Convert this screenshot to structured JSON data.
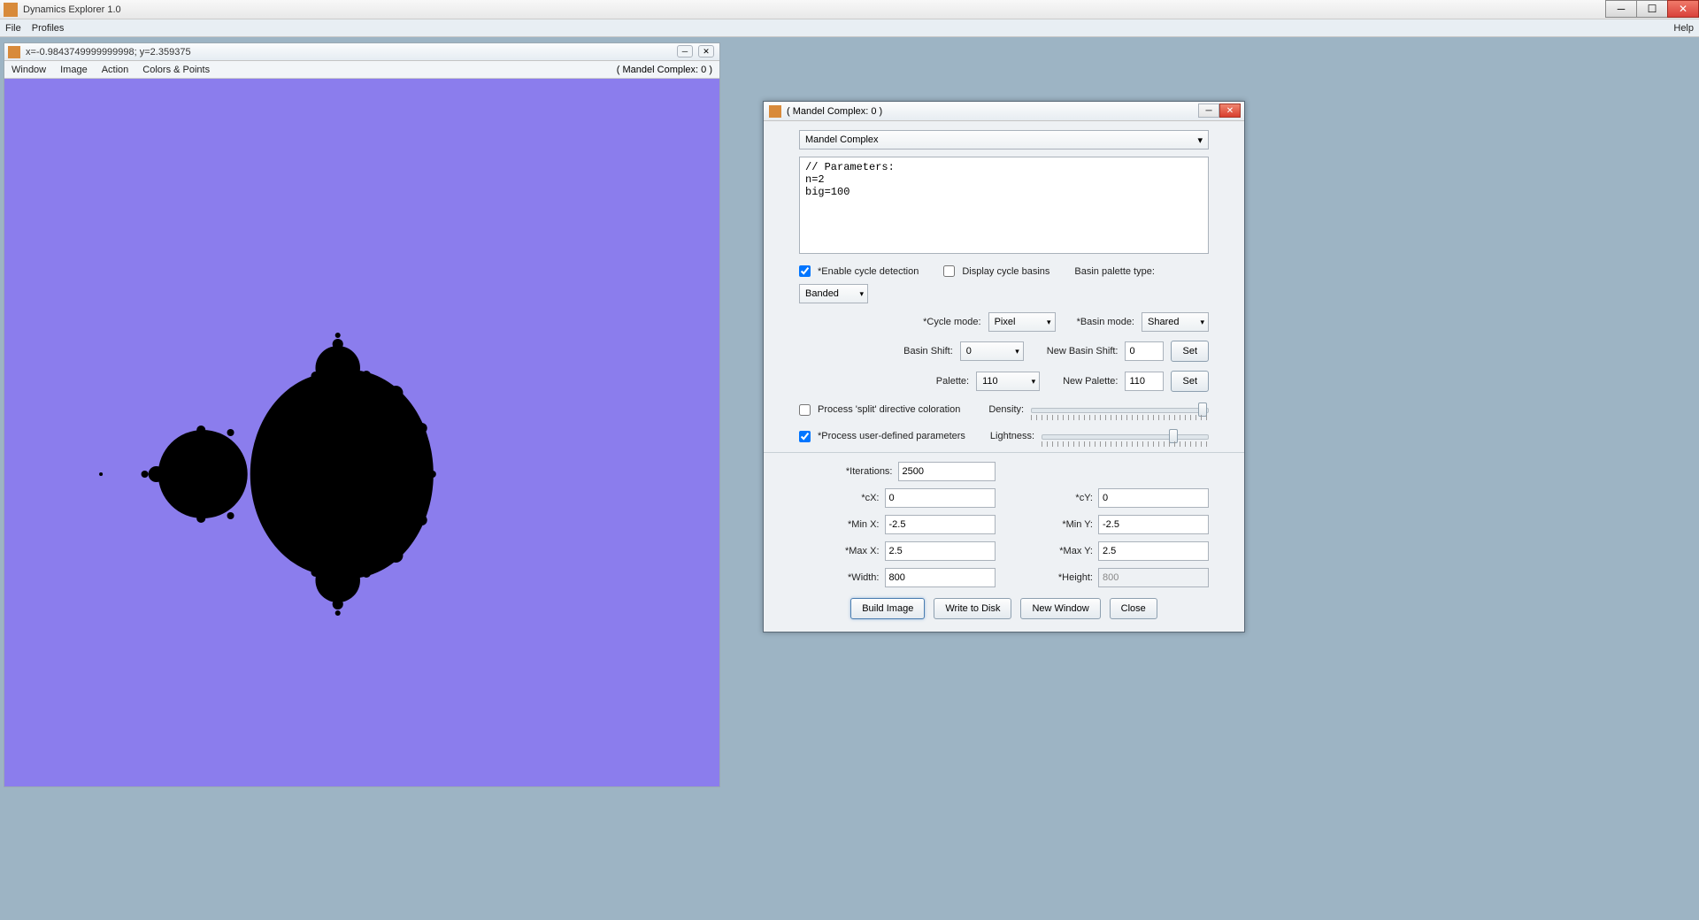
{
  "app": {
    "title": "Dynamics Explorer 1.0",
    "menus": {
      "file": "File",
      "profiles": "Profiles",
      "help": "Help"
    }
  },
  "fractal_window": {
    "coords": "x=-0.9843749999999998; y=2.359375",
    "menus": {
      "window": "Window",
      "image": "Image",
      "action": "Action",
      "colors": "Colors & Points"
    },
    "context_label": "( Mandel Complex: 0 )",
    "viewport_bg": "#8b7ded"
  },
  "dialog": {
    "title": "( Mandel Complex: 0 )",
    "type_select": "Mandel Complex",
    "params_text": "// Parameters:\nn=2\nbig=100",
    "enable_cycle": {
      "label": "*Enable cycle detection",
      "checked": true
    },
    "display_basins": {
      "label": "Display cycle basins",
      "checked": false
    },
    "basin_palette_type": {
      "label": "Basin palette type:",
      "value": "Banded"
    },
    "cycle_mode": {
      "label": "*Cycle mode:",
      "value": "Pixel"
    },
    "basin_mode": {
      "label": "*Basin mode:",
      "value": "Shared"
    },
    "basin_shift": {
      "label": "Basin Shift:",
      "value": "0"
    },
    "new_basin_shift": {
      "label": "New Basin Shift:",
      "value": "0",
      "set": "Set"
    },
    "palette": {
      "label": "Palette:",
      "value": "110"
    },
    "new_palette": {
      "label": "New Palette:",
      "value": "110",
      "set": "Set"
    },
    "process_split": {
      "label": "Process 'split' directive coloration",
      "checked": false
    },
    "density_label": "Density:",
    "process_user_params": {
      "label": "*Process user-defined parameters",
      "checked": true
    },
    "lightness_label": "Lightness:",
    "iterations": {
      "label": "*Iterations:",
      "value": "2500"
    },
    "cx": {
      "label": "*cX:",
      "value": "0"
    },
    "cy": {
      "label": "*cY:",
      "value": "0"
    },
    "minx": {
      "label": "*Min X:",
      "value": "-2.5"
    },
    "miny": {
      "label": "*Min Y:",
      "value": "-2.5"
    },
    "maxx": {
      "label": "*Max X:",
      "value": "2.5"
    },
    "maxy": {
      "label": "*Max Y:",
      "value": "2.5"
    },
    "width": {
      "label": "*Width:",
      "value": "800"
    },
    "height": {
      "label": "*Height:",
      "value": "800"
    },
    "buttons": {
      "build": "Build Image",
      "write": "Write to Disk",
      "newwin": "New Window",
      "close": "Close"
    }
  }
}
